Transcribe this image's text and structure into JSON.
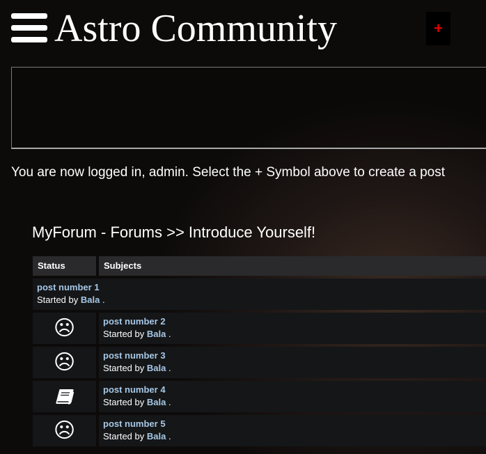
{
  "header": {
    "title": "Astro Community",
    "new_post_label": "+"
  },
  "login_message": "You are now logged in, admin. Select the + Symbol above to create a post",
  "breadcrumb": "MyForum - Forums >> Introduce Yourself!",
  "table": {
    "headers": {
      "status": "Status",
      "subjects": "Subjects"
    },
    "started_by_label": "Started by",
    "rows": [
      {
        "title": "post number 1",
        "author": "Bala",
        "status_icon": "",
        "suffix": " ."
      },
      {
        "title": "post number 2",
        "author": "Bala",
        "status_icon": "☹",
        "status_name": "sad-face-icon",
        "suffix": " ."
      },
      {
        "title": "post number 3",
        "author": "Bala",
        "status_icon": "☹",
        "status_name": "sad-face-icon",
        "suffix": " ."
      },
      {
        "title": "post number 4",
        "author": "Bala",
        "status_icon": "book",
        "status_name": "book-icon",
        "suffix": " ."
      },
      {
        "title": "post number 5",
        "author": "Bala",
        "status_icon": "☹",
        "status_name": "sad-face-icon",
        "suffix": " ."
      }
    ]
  },
  "colors": {
    "link": "#a6c8e6",
    "accent_red": "#e00000",
    "row_bg": "#151618",
    "header_bg": "#2a2a2c"
  }
}
